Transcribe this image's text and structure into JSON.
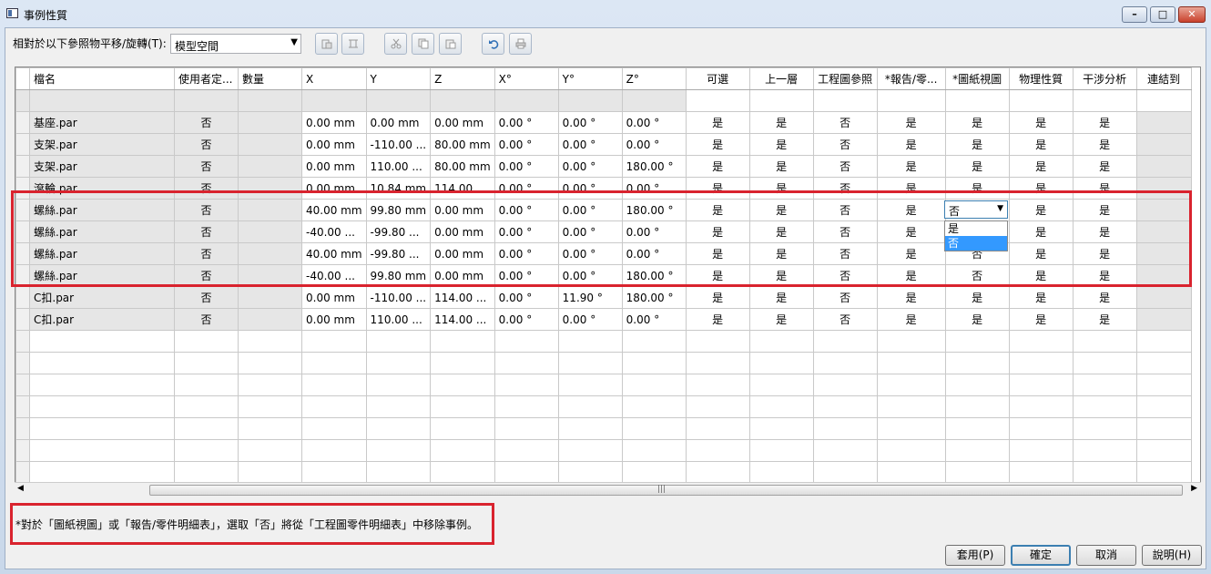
{
  "window": {
    "title": "事例性質"
  },
  "toolbar": {
    "ref_label": "相對於以下參照物平移/旋轉(T):",
    "ref_value": "模型空間",
    "icons": [
      "paste-special-icon",
      "measure-icon",
      "cut-icon",
      "copy-icon",
      "paste-icon",
      "undo-icon",
      "print-icon"
    ]
  },
  "table": {
    "columns": [
      "檔名",
      "使用者定...",
      "數量",
      "X",
      "Y",
      "Z",
      "X°",
      "Y°",
      "Z°",
      "可選",
      "上一層",
      "工程圖參照",
      "*報告/零...",
      "*圖紙視圖",
      "物理性質",
      "干涉分析",
      "連結到"
    ],
    "rows": [
      [
        "基座.par",
        "否",
        "",
        "0.00 mm",
        "0.00 mm",
        "0.00 mm",
        "0.00 °",
        "0.00 °",
        "0.00 °",
        "是",
        "是",
        "否",
        "是",
        "是",
        "是",
        "是",
        ""
      ],
      [
        "支架.par",
        "否",
        "",
        "0.00 mm",
        "-110.00 ...",
        "80.00 mm",
        "0.00 °",
        "0.00 °",
        "0.00 °",
        "是",
        "是",
        "否",
        "是",
        "是",
        "是",
        "是",
        ""
      ],
      [
        "支架.par",
        "否",
        "",
        "0.00 mm",
        "110.00 ...",
        "80.00 mm",
        "0.00 °",
        "0.00 °",
        "180.00 °",
        "是",
        "是",
        "否",
        "是",
        "是",
        "是",
        "是",
        ""
      ],
      [
        "滾輪.par",
        "否",
        "",
        "0.00 mm",
        "10.84 mm",
        "114.00 ...",
        "0.00 °",
        "0.00 °",
        "0.00 °",
        "是",
        "是",
        "否",
        "是",
        "是",
        "是",
        "是",
        ""
      ],
      [
        "螺絲.par",
        "否",
        "",
        "40.00 mm",
        "99.80 mm",
        "0.00 mm",
        "0.00 °",
        "0.00 °",
        "180.00 °",
        "是",
        "是",
        "否",
        "是",
        "否",
        "是",
        "是",
        ""
      ],
      [
        "螺絲.par",
        "否",
        "",
        "-40.00 ...",
        "-99.80 ...",
        "0.00 mm",
        "0.00 °",
        "0.00 °",
        "0.00 °",
        "是",
        "是",
        "否",
        "是",
        "否",
        "是",
        "是",
        ""
      ],
      [
        "螺絲.par",
        "否",
        "",
        "40.00 mm",
        "-99.80 ...",
        "0.00 mm",
        "0.00 °",
        "0.00 °",
        "0.00 °",
        "是",
        "是",
        "否",
        "是",
        "否",
        "是",
        "是",
        ""
      ],
      [
        "螺絲.par",
        "否",
        "",
        "-40.00 ...",
        "99.80 mm",
        "0.00 mm",
        "0.00 °",
        "0.00 °",
        "180.00 °",
        "是",
        "是",
        "否",
        "是",
        "否",
        "是",
        "是",
        ""
      ],
      [
        "C扣.par",
        "否",
        "",
        "0.00 mm",
        "-110.00 ...",
        "114.00 ...",
        "0.00 °",
        "11.90 °",
        "180.00 °",
        "是",
        "是",
        "否",
        "是",
        "是",
        "是",
        "是",
        ""
      ],
      [
        "C扣.par",
        "否",
        "",
        "0.00 mm",
        "110.00 ...",
        "114.00 ...",
        "0.00 °",
        "0.00 °",
        "0.00 °",
        "是",
        "是",
        "否",
        "是",
        "是",
        "是",
        "是",
        ""
      ]
    ]
  },
  "dropdown": {
    "current": "否",
    "options": [
      "是",
      "否"
    ],
    "selected": "否"
  },
  "note": "*對於「圖紙視圖」或「報告/零件明細表」，選取「否」將從「工程圖零件明細表」中移除事例。",
  "buttons": {
    "apply": "套用(P)",
    "ok": "確定",
    "cancel": "取消",
    "help": "說明(H)"
  },
  "colors": {
    "highlight": "#d9232e",
    "selection": "#3399ff",
    "gray_cell": "#e6e6e6"
  }
}
